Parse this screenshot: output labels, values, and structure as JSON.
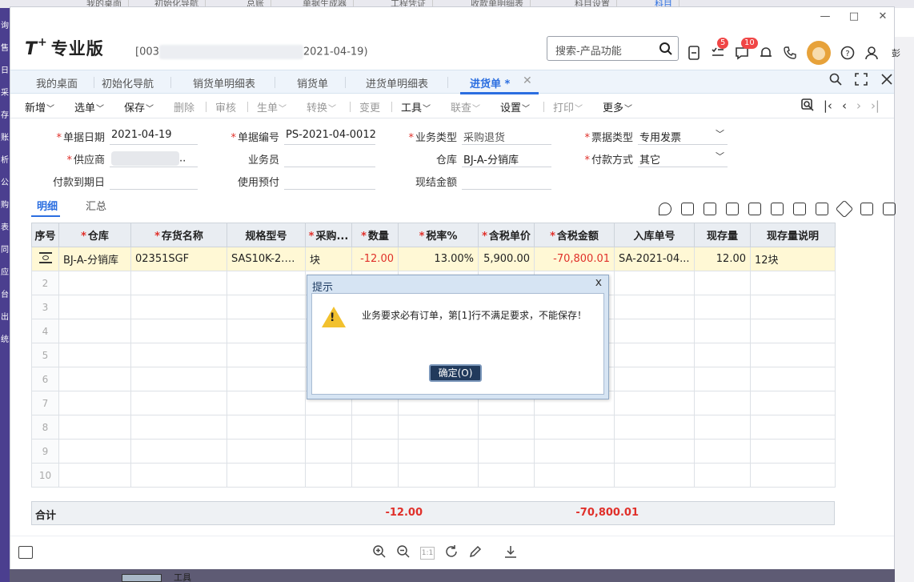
{
  "window": {
    "minimize": "—",
    "maximize": "□",
    "close": "✕"
  },
  "header": {
    "logo": "T",
    "logo_plus": "+",
    "edition": "专业版",
    "account_prefix": "[003",
    "account_suffix": "2021-04-19)",
    "search_placeholder": "搜索-产品功能",
    "badge_tasks": "5",
    "badge_notify": "10",
    "user": "彭"
  },
  "tabs": [
    {
      "label": "我的桌面"
    },
    {
      "label": "初始化导航"
    },
    {
      "label": "销货单明细表"
    },
    {
      "label": "销货单"
    },
    {
      "label": "进货单明细表"
    },
    {
      "label": "进货单 *"
    }
  ],
  "toolbar": {
    "items": [
      {
        "label": "新增",
        "caret": "﹀"
      },
      {
        "label": "选单",
        "caret": "﹀"
      },
      {
        "label": "保存",
        "caret": "﹀"
      },
      {
        "label": "删除"
      },
      {
        "label": "审核"
      },
      {
        "label": "生单",
        "caret": "﹀"
      },
      {
        "label": "转换",
        "caret": "﹀"
      },
      {
        "label": "变更"
      },
      {
        "label": "工具",
        "caret": "﹀"
      },
      {
        "label": "联查",
        "caret": "﹀"
      },
      {
        "label": "设置",
        "caret": "﹀"
      },
      {
        "label": "打印",
        "caret": "﹀"
      },
      {
        "label": "更多",
        "caret": "﹀"
      }
    ]
  },
  "form": {
    "date_label": "单据日期",
    "date_value": "2021-04-19",
    "no_label": "单据编号",
    "no_value": "PS-2021-04-0012",
    "biz_label": "业务类型",
    "biz_value": "采购退货",
    "invoice_label": "票据类型",
    "invoice_value": "专用发票",
    "supplier_label": "供应商",
    "supplier_value": "..",
    "staff_label": "业务员",
    "staff_value": "",
    "warehouse_label": "仓库",
    "warehouse_value": "BJ-A-分销库",
    "payment_label": "付款方式",
    "payment_value": "其它",
    "due_label": "付款到期日",
    "due_value": "",
    "prepay_label": "使用预付",
    "prepay_value": "",
    "cash_label": "现结金额",
    "cash_value": ""
  },
  "subtabs": {
    "detail": "明细",
    "summary": "汇总"
  },
  "table": {
    "headers": [
      "序号",
      "仓库",
      "存货名称",
      "规格型号",
      "采购...",
      "数量",
      "税率%",
      "含税单价",
      "含税金额",
      "入库单号",
      "现存量",
      "现存量说明"
    ],
    "required": [
      false,
      true,
      true,
      false,
      true,
      true,
      true,
      true,
      true,
      false,
      false,
      false
    ],
    "row1": {
      "warehouse": "BJ-A-分销库",
      "item": "02351SGF",
      "spec": "SAS10K-2.4...",
      "unit": "块",
      "qty": "-12.00",
      "tax": "13.00%",
      "price": "5,900.00",
      "amount": "-70,800.01",
      "receipt": "SA-2021-04...",
      "stock": "12.00",
      "stock_note": "12块"
    },
    "row_numbers": [
      "2",
      "3",
      "4",
      "5",
      "6",
      "7",
      "8",
      "9",
      "10"
    ]
  },
  "total": {
    "label": "合计",
    "qty": "-12.00",
    "amount": "-70,800.01"
  },
  "bottombar": {
    "page": "1:1"
  },
  "dialog": {
    "title": "提示",
    "close": "x",
    "message": "业务要求必有订单，第[1]行不满足要求，不能保存！",
    "ok": "确定(O)"
  },
  "background": {
    "tabs": [
      "我的桌面",
      "初始化导航",
      "总账",
      "单据生成器",
      "工程凭证",
      "收款单明细表",
      "科目设置",
      "科目"
    ],
    "left_chars": [
      "询",
      "售",
      "日",
      "采",
      "存",
      "账",
      "析",
      "公",
      "购",
      "表",
      "同",
      "应",
      "台",
      "出",
      "统"
    ],
    "thumb_text": "工具"
  },
  "colors": {
    "accent": "#2b6ee0",
    "required": "#e0302a",
    "selected_row": "#fff8d5",
    "dialog_btn": "#213a5c"
  }
}
